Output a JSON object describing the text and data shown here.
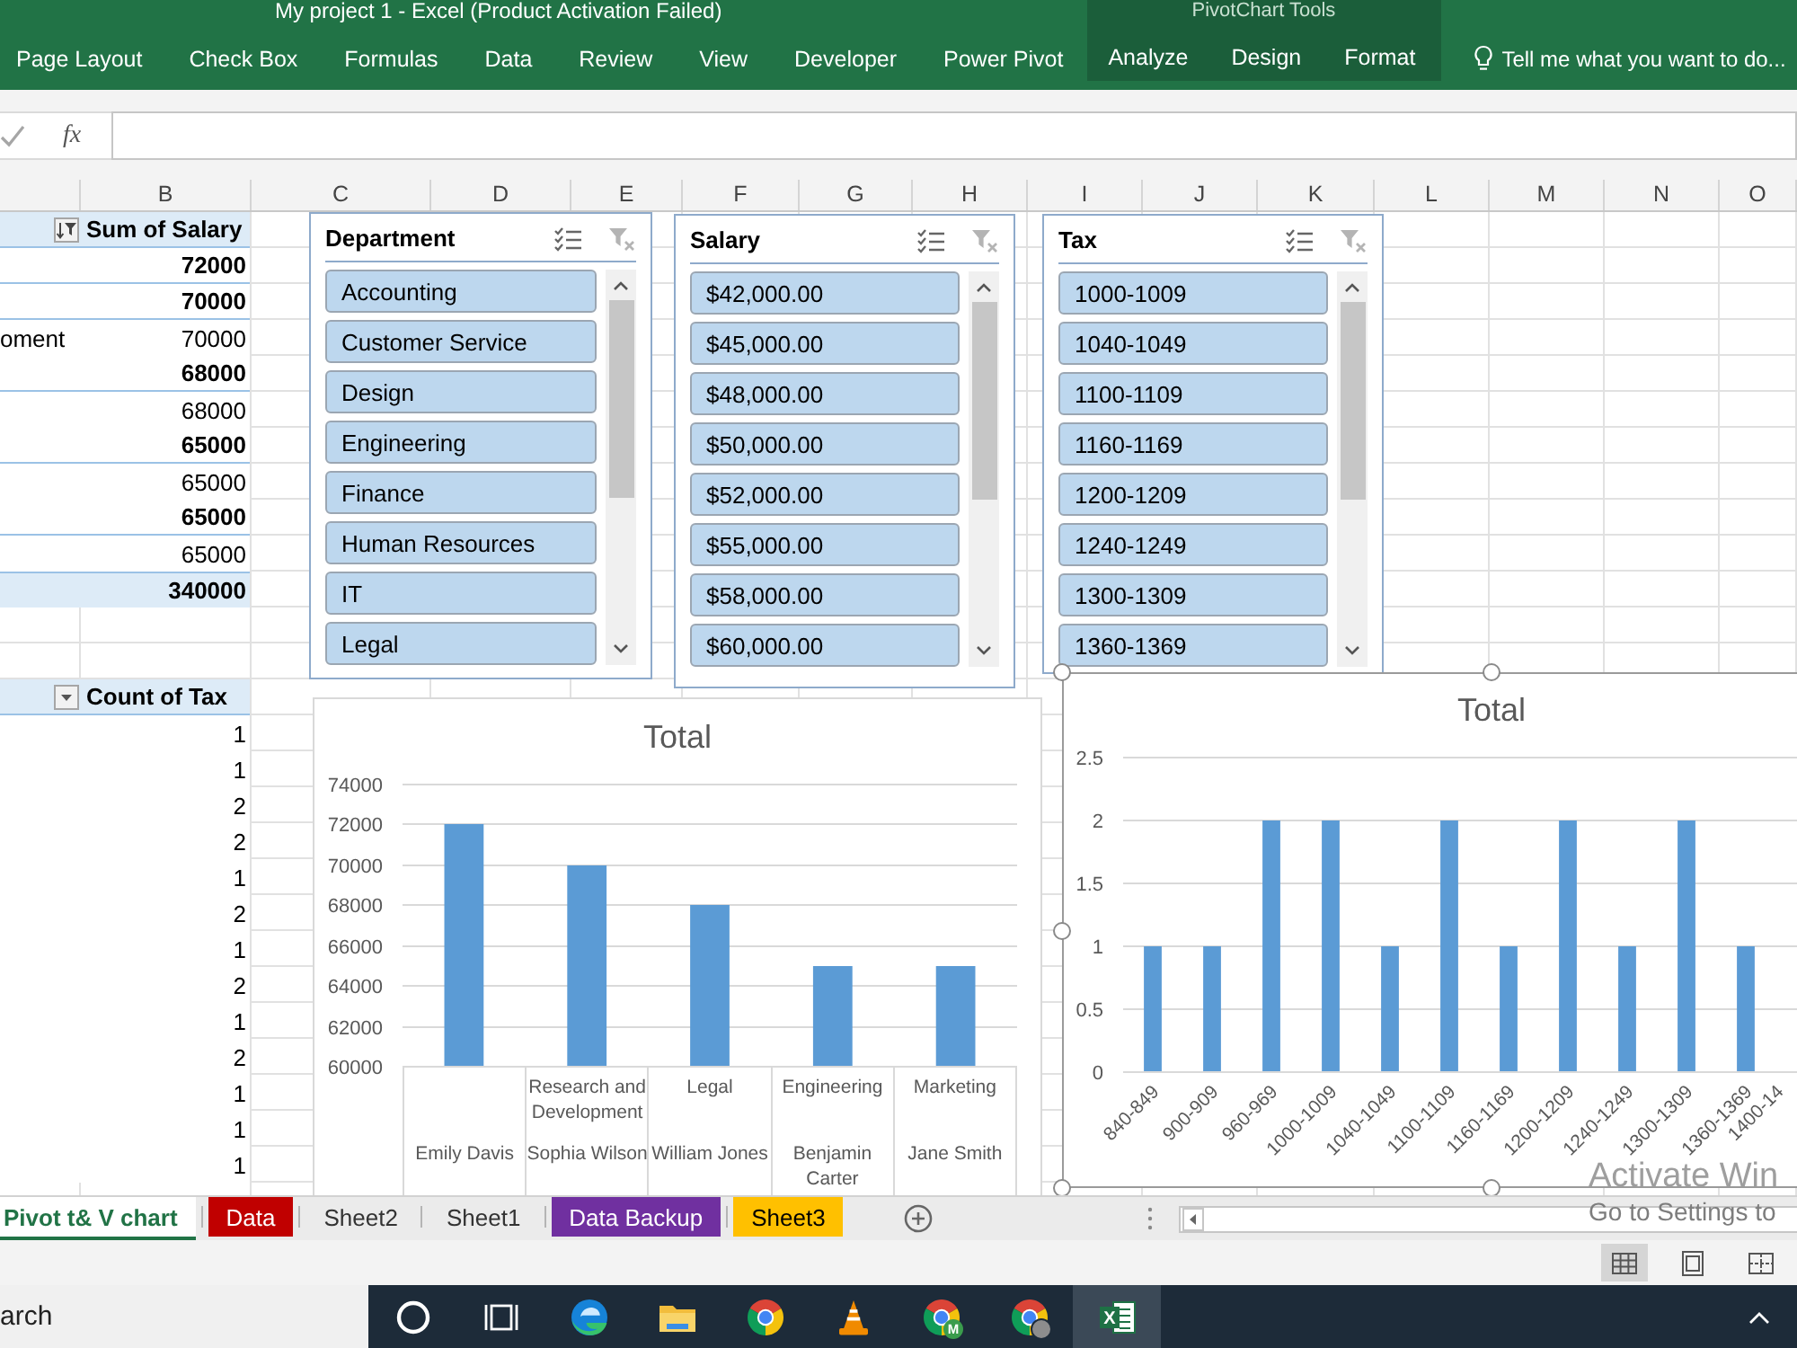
{
  "window": {
    "title": "My project 1 - Excel (Product Activation Failed)",
    "tool_group": "PivotChart Tools"
  },
  "ribbon": {
    "tabs": [
      {
        "label": "Page Layout",
        "contextual": false,
        "selected": false
      },
      {
        "label": "Check Box",
        "contextual": false,
        "selected": false
      },
      {
        "label": "Formulas",
        "contextual": false,
        "selected": false
      },
      {
        "label": "Data",
        "contextual": false,
        "selected": false
      },
      {
        "label": "Review",
        "contextual": false,
        "selected": false
      },
      {
        "label": "View",
        "contextual": false,
        "selected": false
      },
      {
        "label": "Developer",
        "contextual": false,
        "selected": false
      },
      {
        "label": "Power Pivot",
        "contextual": false,
        "selected": false
      },
      {
        "label": "Analyze",
        "contextual": true,
        "selected": false
      },
      {
        "label": "Design",
        "contextual": true,
        "selected": false
      },
      {
        "label": "Format",
        "contextual": true,
        "selected": false
      }
    ],
    "tell_me": {
      "placeholder": "Tell me what you want to do..."
    }
  },
  "formula_bar": {
    "function_button": "fx"
  },
  "sheet": {
    "columns": [
      "B",
      "C",
      "D",
      "E",
      "F",
      "G",
      "H",
      "I",
      "J",
      "K",
      "L",
      "M",
      "N",
      "O"
    ],
    "pivot_tables": [
      {
        "header": "Sum of Salary",
        "filtered": true,
        "rows": [
          {
            "kind": "group",
            "value": "72000"
          },
          {
            "kind": "group",
            "value": "70000"
          },
          {
            "kind": "item",
            "label": "oment",
            "value": "70000"
          },
          {
            "kind": "group",
            "value": "68000"
          },
          {
            "kind": "item",
            "value": "68000"
          },
          {
            "kind": "group",
            "value": "65000"
          },
          {
            "kind": "item",
            "value": "65000"
          },
          {
            "kind": "group",
            "value": "65000"
          },
          {
            "kind": "item",
            "value": "65000"
          },
          {
            "kind": "total",
            "value": "340000"
          }
        ]
      },
      {
        "header": "Count of Tax",
        "filtered": false,
        "rows": [
          {
            "kind": "item",
            "value": "1"
          },
          {
            "kind": "item",
            "value": "1"
          },
          {
            "kind": "item",
            "value": "2"
          },
          {
            "kind": "item",
            "value": "2"
          },
          {
            "kind": "item",
            "value": "1"
          },
          {
            "kind": "item",
            "value": "2"
          },
          {
            "kind": "item",
            "value": "1"
          },
          {
            "kind": "item",
            "value": "2"
          },
          {
            "kind": "item",
            "value": "1"
          },
          {
            "kind": "item",
            "value": "2"
          },
          {
            "kind": "item",
            "value": "1"
          },
          {
            "kind": "item",
            "value": "1"
          },
          {
            "kind": "item",
            "value": "1"
          }
        ]
      }
    ],
    "slicers": [
      {
        "title": "Department",
        "clear_disabled": true,
        "items": [
          {
            "label": "Accounting",
            "selected": true
          },
          {
            "label": "Customer Service",
            "selected": true
          },
          {
            "label": "Design",
            "selected": true
          },
          {
            "label": "Engineering",
            "selected": true
          },
          {
            "label": "Finance",
            "selected": true
          },
          {
            "label": "Human Resources",
            "selected": true
          },
          {
            "label": "IT",
            "selected": true
          },
          {
            "label": "Legal",
            "selected": true
          }
        ]
      },
      {
        "title": "Salary",
        "clear_disabled": true,
        "items": [
          {
            "label": "$42,000.00",
            "selected": true
          },
          {
            "label": "$45,000.00",
            "selected": true
          },
          {
            "label": "$48,000.00",
            "selected": true
          },
          {
            "label": "$50,000.00",
            "selected": true
          },
          {
            "label": "$52,000.00",
            "selected": true
          },
          {
            "label": "$55,000.00",
            "selected": true
          },
          {
            "label": "$58,000.00",
            "selected": true
          },
          {
            "label": "$60,000.00",
            "selected": true
          }
        ]
      },
      {
        "title": "Tax",
        "clear_disabled": true,
        "items": [
          {
            "label": "1000-1009",
            "selected": true
          },
          {
            "label": "1040-1049",
            "selected": true
          },
          {
            "label": "1100-1109",
            "selected": true
          },
          {
            "label": "1160-1169",
            "selected": true
          },
          {
            "label": "1200-1209",
            "selected": true
          },
          {
            "label": "1240-1249",
            "selected": true
          },
          {
            "label": "1300-1309",
            "selected": true
          },
          {
            "label": "1360-1369",
            "selected": true
          }
        ]
      }
    ],
    "charts": [
      {
        "selected": false,
        "chart_data": {
          "type": "bar",
          "title": "Total",
          "categories": [
            "Emily Davis",
            "Sophia Wilson",
            "William Jones",
            "Benjamin Carter",
            "Jane Smith"
          ],
          "annotations": [
            "Research and Development",
            "Legal",
            "Engineering",
            "Marketing"
          ],
          "series": [
            {
              "color": "#5b9bd5",
              "values": [
                72000,
                70000,
                68000,
                65000,
                65000
              ]
            }
          ],
          "ylim": [
            60000,
            74000
          ],
          "yticks": [
            60000,
            62000,
            64000,
            66000,
            68000,
            70000,
            72000,
            74000
          ],
          "grid": true
        }
      },
      {
        "selected": true,
        "chart_data": {
          "type": "bar",
          "title": "Total",
          "categories": [
            "840-849",
            "900-909",
            "960-969",
            "1000-1009",
            "1040-1049",
            "1100-1109",
            "1160-1169",
            "1200-1209",
            "1240-1249",
            "1300-1309",
            "1360-1369",
            "1400-14"
          ],
          "series": [
            {
              "color": "#5b9bd5",
              "values": [
                1,
                1,
                2,
                2,
                1,
                2,
                1,
                2,
                1,
                2,
                1,
                null
              ]
            }
          ],
          "ylim": [
            0,
            2.5
          ],
          "yticks": [
            0,
            0.5,
            1,
            1.5,
            2,
            2.5
          ],
          "grid": true
        }
      }
    ]
  },
  "sheet_tabs": [
    {
      "label": "Pivot t& V chart",
      "selected": true
    },
    {
      "label": "Data",
      "selected": false,
      "color": "#c00000"
    },
    {
      "label": "Sheet2",
      "selected": false
    },
    {
      "label": "Sheet1",
      "selected": false
    },
    {
      "label": "Data Backup",
      "selected": false,
      "color": "#7030a0"
    },
    {
      "label": "Sheet3",
      "selected": false,
      "color": "#ffc000"
    }
  ],
  "status_bar": {
    "views": [
      {
        "kind": "normal",
        "selected": true
      },
      {
        "kind": "page_layout",
        "selected": false
      },
      {
        "kind": "page_break",
        "selected": false
      }
    ]
  },
  "taskbar": {
    "search": {
      "placeholder": "arch"
    },
    "apps": [
      {
        "kind": "cortana",
        "active": false
      },
      {
        "kind": "task_view",
        "active": false
      },
      {
        "kind": "edge",
        "active": false
      },
      {
        "kind": "explorer",
        "active": false
      },
      {
        "kind": "chrome",
        "active": false
      },
      {
        "kind": "vlc",
        "active": false
      },
      {
        "kind": "chrome",
        "badge": "M",
        "active": false
      },
      {
        "kind": "chrome_avatar",
        "active": false
      },
      {
        "kind": "excel",
        "glyph": "X",
        "active": true
      }
    ]
  },
  "activation_notice": {
    "title": "Activate Win",
    "text": "Go to Settings to"
  }
}
